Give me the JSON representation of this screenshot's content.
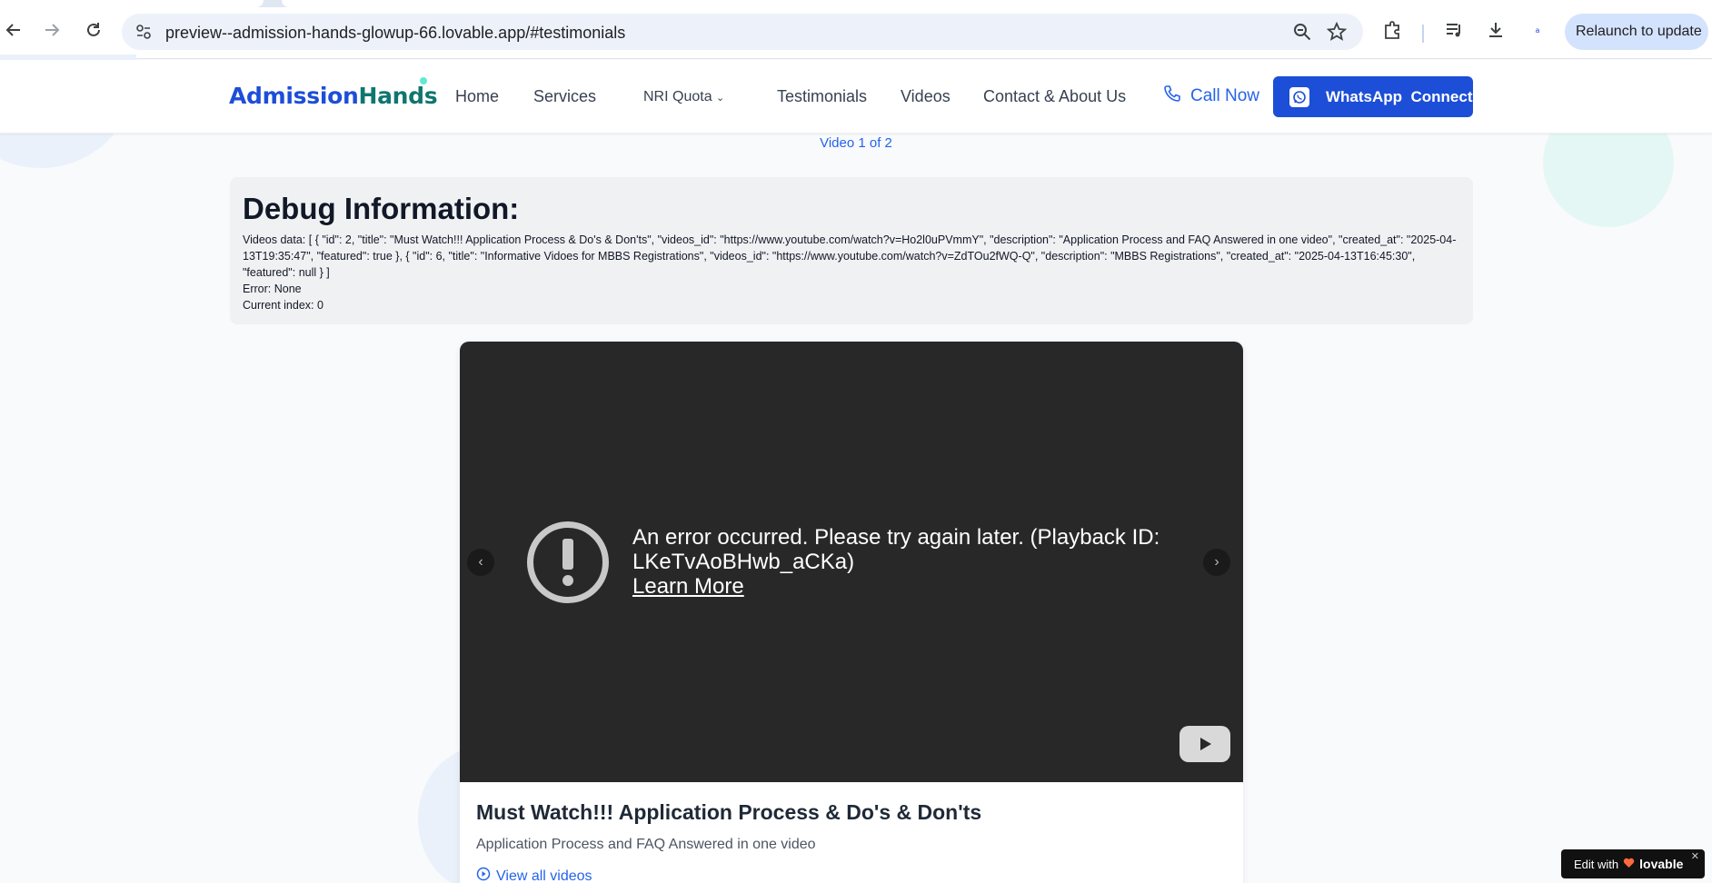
{
  "browser": {
    "url": "preview--admission-hands-glowup-66.lovable.app/#testimonials",
    "relaunch_label": "Relaunch to update"
  },
  "site": {
    "logo_part1": "Admission",
    "logo_part2": "Hands",
    "nav": {
      "home": "Home",
      "services": "Services",
      "nri_quota": "NRI Quota",
      "testimonials": "Testimonials",
      "videos": "Videos",
      "contact": "Contact & About Us"
    },
    "call_now": "Call Now",
    "whatsapp_label": "WhatsApp  Connect"
  },
  "video_counter": "Video 1 of 2",
  "debug": {
    "heading": "Debug Information:",
    "videos_data": "Videos data: [ { \"id\": 2, \"title\": \"Must Watch!!! Application Process & Do's & Don'ts\", \"videos_id\": \"https://www.youtube.com/watch?v=Ho2l0uPVmmY\", \"description\": \"Application Process and FAQ Answered in one video\", \"created_at\": \"2025-04-13T19:35:47\", \"featured\": true }, { \"id\": 6, \"title\": \"Informative Vidoes for MBBS Registrations\", \"videos_id\": \"https://www.youtube.com/watch?v=ZdTOu2fWQ-Q\", \"description\": \"MBBS Registrations\", \"created_at\": \"2025-04-13T16:45:30\", \"featured\": null } ]",
    "error": "Error: None",
    "current_index": "Current index: 0"
  },
  "player": {
    "error_message": "An error occurred. Please try again later. (Playback ID: LKeTvAoBHwb_aCKa)",
    "learn_more": "Learn More"
  },
  "video": {
    "title": "Must Watch!!! Application Process & Do's & Don'ts",
    "description": "Application Process and FAQ Answered in one video",
    "view_all": "View all videos"
  },
  "lovable_badge": {
    "prefix": "Edit with",
    "brand": "lovable"
  },
  "colors": {
    "primary": "#1d4ed8",
    "accent_teal": "#0f766e",
    "player_bg": "#282828"
  }
}
